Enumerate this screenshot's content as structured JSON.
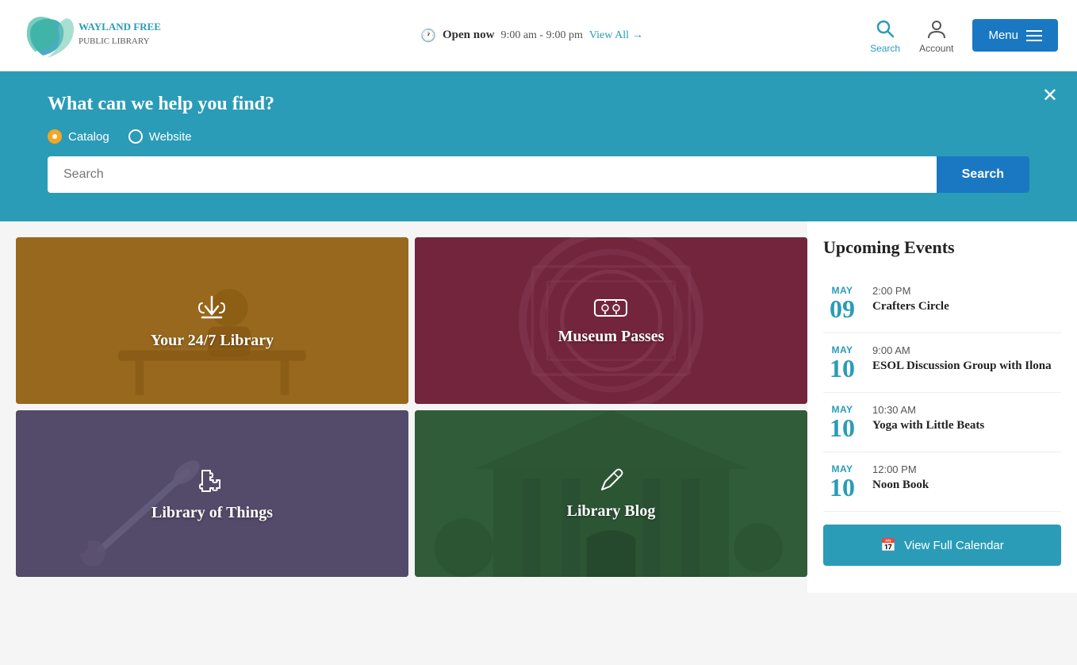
{
  "header": {
    "logo_alt": "Wayland Free Public Library",
    "open_status": "Open now",
    "hours": "9:00 am - 9:00 pm",
    "view_all": "View All",
    "search_label": "Search",
    "account_label": "Account",
    "menu_label": "Menu"
  },
  "search_banner": {
    "title": "What can we help you find?",
    "option_catalog": "Catalog",
    "option_website": "Website",
    "placeholder": "Search",
    "search_button": "Search",
    "selected": "catalog"
  },
  "tiles": [
    {
      "id": "library-24",
      "label": "Your 24/7 Library",
      "icon": "⬇",
      "icon_type": "download"
    },
    {
      "id": "museum",
      "label": "Museum Passes",
      "icon": "🎫",
      "icon_type": "ticket"
    },
    {
      "id": "things",
      "label": "Library of Things",
      "icon": "🧩",
      "icon_type": "puzzle"
    },
    {
      "id": "blog",
      "label": "Library Blog",
      "icon": "✏",
      "icon_type": "pencil"
    }
  ],
  "sidebar": {
    "title": "Upcoming Events",
    "events": [
      {
        "month": "MAY",
        "day": "09",
        "time": "2:00 PM",
        "name": "Crafters Circle"
      },
      {
        "month": "MAY",
        "day": "10",
        "time": "9:00 AM",
        "name": "ESOL Discussion Group with Ilona"
      },
      {
        "month": "MAY",
        "day": "10",
        "time": "10:30 AM",
        "name": "Yoga with Little Beats"
      },
      {
        "month": "MAY",
        "day": "10",
        "time": "12:00 PM",
        "name": "Noon Book"
      }
    ],
    "calendar_btn": "View Full Calendar"
  }
}
